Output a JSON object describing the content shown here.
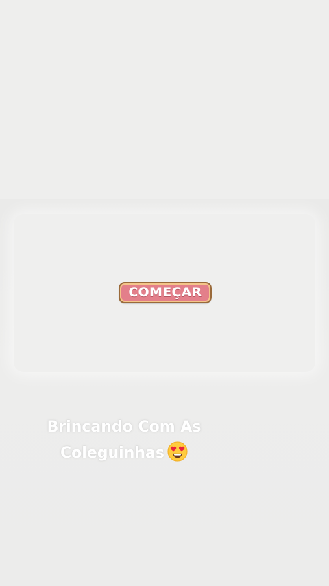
{
  "start_button": {
    "label": "COMEÇAR"
  },
  "caption": {
    "line1": "Brincando Com As",
    "line2": "Coleguinhas",
    "emoji": "heart-eyes-emoji"
  },
  "colors": {
    "background": "#ececeb",
    "button_fill": "#e37f8a",
    "button_border": "#9a6a3a",
    "caption_text": "#ffffff"
  }
}
